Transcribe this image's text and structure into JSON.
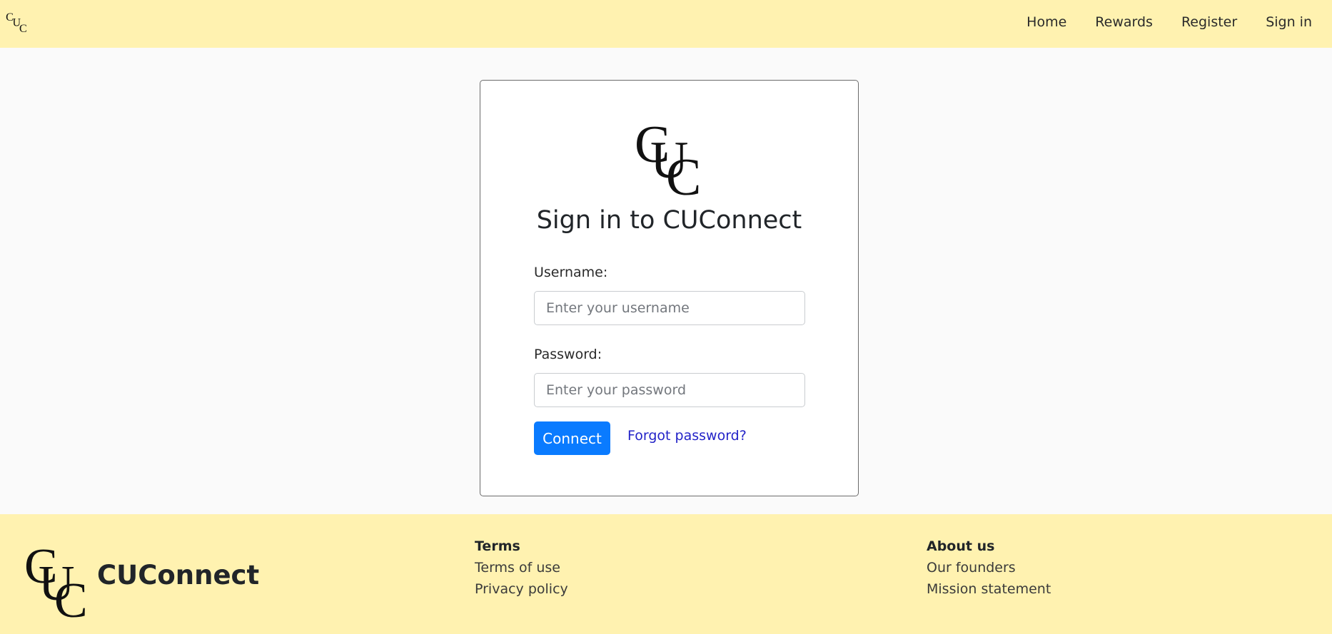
{
  "brand": {
    "name": "CUConnect",
    "logo_letters": "CUC"
  },
  "navbar": {
    "links": [
      "Home",
      "Rewards",
      "Register",
      "Sign in"
    ]
  },
  "signin": {
    "title": "Sign in to CUConnect",
    "username_label": "Username:",
    "username_placeholder": "Enter your username",
    "username_value": "",
    "password_label": "Password:",
    "password_placeholder": "Enter your password",
    "password_value": "",
    "connect_label": "Connect",
    "forgot_label": "Forgot password?"
  },
  "footer": {
    "terms": {
      "title": "Terms",
      "links": [
        "Terms of use",
        "Privacy policy"
      ]
    },
    "about": {
      "title": "About us",
      "links": [
        "Our founders",
        "Mission statement"
      ]
    }
  },
  "icons": {
    "logo": "cuc-monogram-icon"
  },
  "colors": {
    "navbar_bg": "#fff2b0",
    "page_bg": "#fafafa",
    "primary_button": "#0a7bff",
    "link": "#2323c8"
  }
}
